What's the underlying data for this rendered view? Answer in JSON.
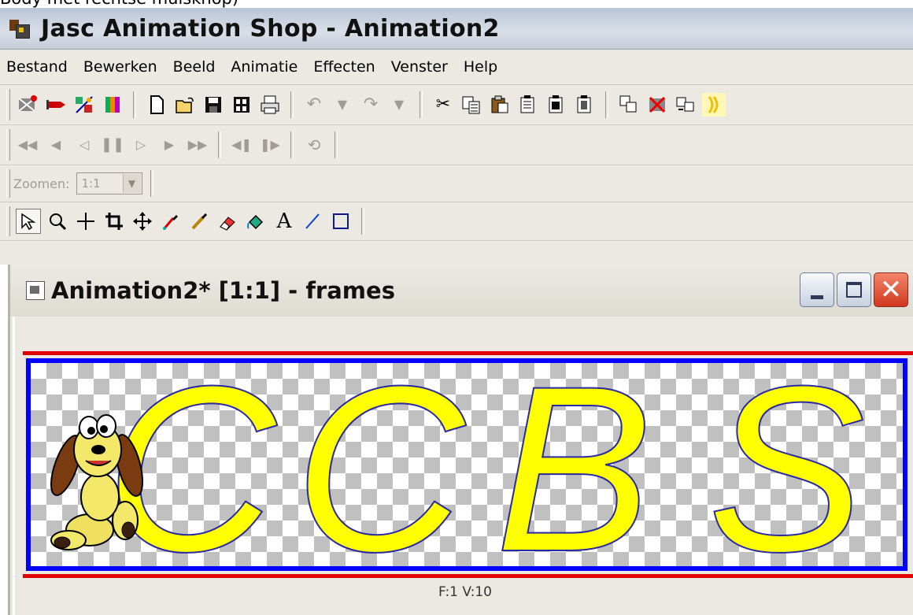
{
  "caption": "Body met rechtse muisknop)",
  "app": {
    "title": "Jasc Animation Shop - Animation2"
  },
  "menu": [
    "Bestand",
    "Bewerken",
    "Beeld",
    "Animatie",
    "Effecten",
    "Venster",
    "Help"
  ],
  "zoom": {
    "label": "Zoomen:",
    "value": "1:1"
  },
  "document": {
    "title": "Animation2* [1:1] - frames",
    "frame_letters": [
      "C",
      "C",
      "B",
      "S"
    ],
    "status": "F:1  V:10"
  },
  "colors": {
    "letter_fill": "#ffff00",
    "letter_stroke": "#2a2aa0",
    "frame_border": "#0000ff",
    "accent_red": "#e10000"
  },
  "icons": {
    "toolbar1": [
      "wizard-icon",
      "banner-wizard-icon",
      "transition-icon",
      "effect-icon",
      "new-icon",
      "open-icon",
      "save-icon",
      "save-frames-icon",
      "print-icon",
      "undo-icon",
      "undo-dropdown-icon",
      "redo-icon",
      "redo-dropdown-icon",
      "cut-icon",
      "copy-icon",
      "paste-icon",
      "paste-before-icon",
      "paste-after-icon",
      "paste-into-icon",
      "duplicate-icon",
      "delete-icon",
      "insert-frames-icon",
      "highlight-icon"
    ],
    "toolbar2": [
      "first-frame-icon",
      "previous-frame-icon",
      "step-back-icon",
      "pause-icon",
      "play-icon",
      "next-frame-icon",
      "last-frame-icon",
      "rewind-icon",
      "forward-icon",
      "loop-icon"
    ],
    "toolbar4": [
      "arrow-select-icon",
      "zoom-icon",
      "crosshair-icon",
      "crop-icon",
      "move-icon",
      "dropper-icon",
      "brush-icon",
      "eraser-icon",
      "fill-icon",
      "text-icon",
      "line-icon",
      "rectangle-icon"
    ]
  }
}
